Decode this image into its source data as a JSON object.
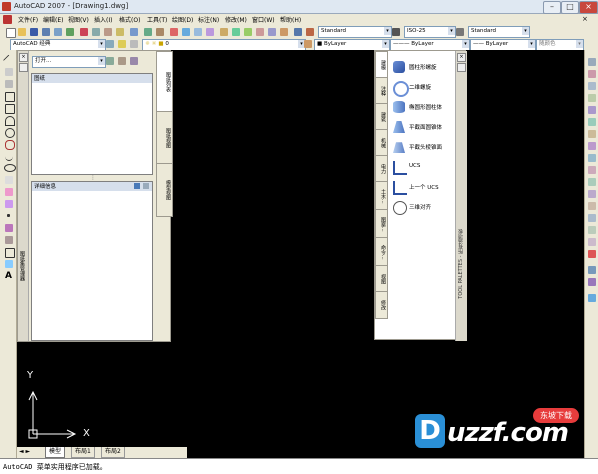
{
  "window": {
    "title": "AutoCAD 2007 - [Drawing1.dwg]"
  },
  "menu": {
    "items": [
      "文件(F)",
      "编辑(E)",
      "视图(V)",
      "插入(I)",
      "格式(O)",
      "工具(T)",
      "绘图(D)",
      "标注(N)",
      "修改(M)",
      "窗口(W)",
      "帮助(H)"
    ]
  },
  "toolbar2": {
    "workspace": "AutoCAD 经典",
    "layer": "0",
    "color": "ByLayer",
    "linetype": "ByLayer",
    "lineweight": "ByLayer",
    "plotstyle": "随颜色"
  },
  "styles": {
    "text": "Standard",
    "dim": "ISO-25",
    "table": "Standard"
  },
  "design_center": {
    "open_label": "打开...",
    "pane1_title": "图纸",
    "pane2_title": "详细信息",
    "tabs": [
      "图纸列表",
      "图纸视图",
      "模型视图"
    ],
    "vertical_label": "图纸集管理器"
  },
  "tool_palette": {
    "title": "TOOL PALETTES - 所有选项板",
    "tabs": [
      "建模",
      "注释",
      "建筑",
      "机械",
      "电力",
      "土木...",
      "图案...",
      "命令...",
      "视图",
      "修改"
    ],
    "items": [
      {
        "label": "圆柱形螺旋",
        "icon": "helix-icon"
      },
      {
        "label": "二维螺旋",
        "icon": "spiral-icon"
      },
      {
        "label": "椭圆形圆柱体",
        "icon": "elliptic-cylinder-icon"
      },
      {
        "label": "平截面圆锥体",
        "icon": "frustum-cone-icon"
      },
      {
        "label": "平截头棱锥面",
        "icon": "frustum-pyramid-icon"
      },
      {
        "label": "UCS",
        "icon": "ucs-icon"
      },
      {
        "label": "上一个 UCS",
        "icon": "ucs-previous-icon"
      },
      {
        "label": "三维对齐",
        "icon": "3d-align-icon"
      }
    ]
  },
  "ucs": {
    "x": "X",
    "y": "Y"
  },
  "layout_tabs": [
    "模型",
    "布局1",
    "布局2"
  ],
  "command_line": {
    "text": "AutoCAD 菜单实用程序已加载。"
  },
  "watermark": {
    "text": "uzzf.com",
    "tag": "东坡下载"
  }
}
